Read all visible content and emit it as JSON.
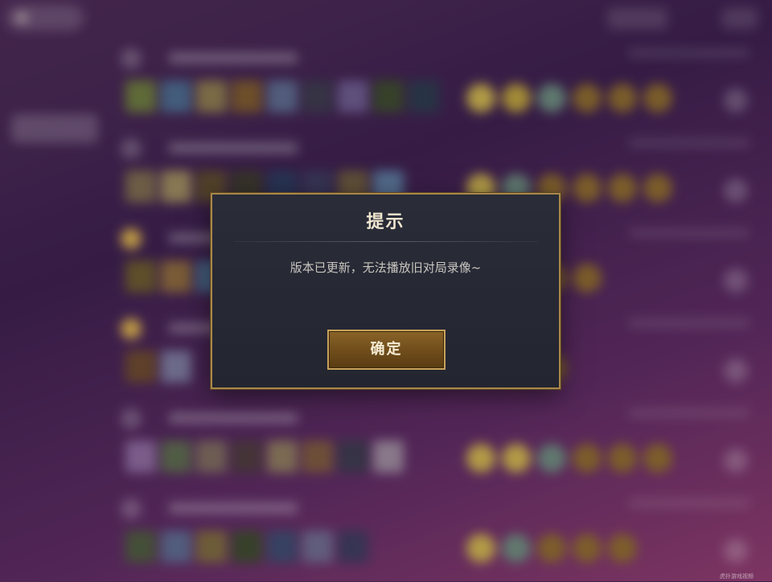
{
  "background": {
    "rows": [
      {
        "rank_style": "dark",
        "champs": [
          "#6a7a3a",
          "#4a6a8a",
          "#8a7a4a",
          "#7a5a2a",
          "#5a6a8a",
          "#3a3a4a",
          "#6a5a8a",
          "#3a4a2a",
          "#2a3a4a"
        ],
        "items": [
          "#c9b24a",
          "#b9a03a",
          "#6a8a7a",
          "#8a6a2a",
          "#8a6a2a",
          "#8a6a2a"
        ]
      },
      {
        "rank_style": "dark",
        "champs": [
          "#7a6a4a",
          "#9a8a5a",
          "#5a4a2a",
          "#3a3a2a",
          "#2a3a5a",
          "#3a3a5a",
          "#6a5a3a",
          "#5a7a9a"
        ],
        "items": [
          "#c9b24a",
          "#6a8a7a",
          "#8a6a2a",
          "#8a6a2a",
          "#8a6a2a",
          "#8a6a2a"
        ]
      },
      {
        "rank_style": "gold",
        "champs": [
          "#6a5a2a",
          "#8a6a3a",
          "#4a6a8a"
        ],
        "items": [
          "#c9b24a",
          "#8a6a2a",
          "#8a6a2a",
          "#8a6a2a"
        ]
      },
      {
        "rank_style": "gold",
        "champs": [
          "#6a4a2a",
          "#7a7a9a"
        ],
        "items": [
          "#6a8a7a",
          "#8a6a2a",
          "#8a6a2a"
        ]
      },
      {
        "rank_style": "dark",
        "champs": [
          "#8a6a9a",
          "#5a6a4a",
          "#7a6a5a",
          "#4a3a3a",
          "#8a7a5a",
          "#7a5a3a",
          "#3a3a4a",
          "#9a8a9a"
        ],
        "items": [
          "#c9b24a",
          "#c9b24a",
          "#6a8a7a",
          "#8a6a2a",
          "#8a6a2a",
          "#8a6a2a"
        ]
      },
      {
        "rank_style": "dark",
        "champs": [
          "#4a5a3a",
          "#5a6a8a",
          "#7a6a3a",
          "#3a4a2a",
          "#3a4a6a",
          "#6a6a8a",
          "#3a3a5a"
        ],
        "items": [
          "#c9b24a",
          "#6a8a7a",
          "#8a6a2a",
          "#8a6a2a",
          "#8a6a2a"
        ]
      }
    ]
  },
  "dialog": {
    "title": "提示",
    "message": "版本已更新，无法播放旧对局录像~",
    "confirm_label": "确定"
  },
  "colors": {
    "dialog_border": "#a9874a",
    "button_gold": "#8a6328",
    "title_text": "#f0e6cf"
  },
  "icons": [
    "back-arrow-icon"
  ],
  "watermark": "虎扑游戏视频"
}
